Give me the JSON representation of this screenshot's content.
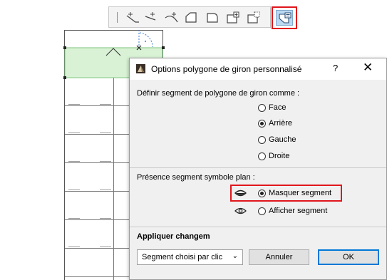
{
  "toolbar": {
    "buttons": [
      {
        "icon": "edge-add-point-icon"
      },
      {
        "icon": "edge-add-point-alt-icon"
      },
      {
        "icon": "arc-edge-icon"
      },
      {
        "icon": "chamfer-corner-icon"
      },
      {
        "icon": "offset-polygon-icon"
      },
      {
        "icon": "add-polygon-icon"
      },
      {
        "icon": "subtract-polygon-icon"
      },
      {
        "icon": "custom-tread-polygon-icon",
        "highlighted": true
      }
    ]
  },
  "dialog": {
    "title": "Options polygone de giron personnalisé",
    "help": "?",
    "close": "✕",
    "segment_section": {
      "label": "Définir segment de polygone de giron comme :",
      "options": [
        {
          "label": "Face",
          "checked": false
        },
        {
          "label": "Arrière",
          "checked": true
        },
        {
          "label": "Gauche",
          "checked": false
        },
        {
          "label": "Droite",
          "checked": false
        }
      ]
    },
    "symbol_section": {
      "label": "Présence segment symbole plan :",
      "options": [
        {
          "label": "Masquer segment",
          "checked": true,
          "icon": "hidden-eye-icon"
        },
        {
          "label": "Afficher segment",
          "checked": false,
          "icon": "eye-icon"
        }
      ]
    },
    "apply": {
      "label": "Appliquer changem",
      "select_value": "Segment choisi par clic"
    },
    "buttons": {
      "cancel": "Annuler",
      "ok": "OK"
    }
  },
  "colors": {
    "highlight": "#e0161c",
    "dialog_bg": "#f0f0f0",
    "tread_fill": "#d9f2d5",
    "ok_border": "#0078d7"
  }
}
